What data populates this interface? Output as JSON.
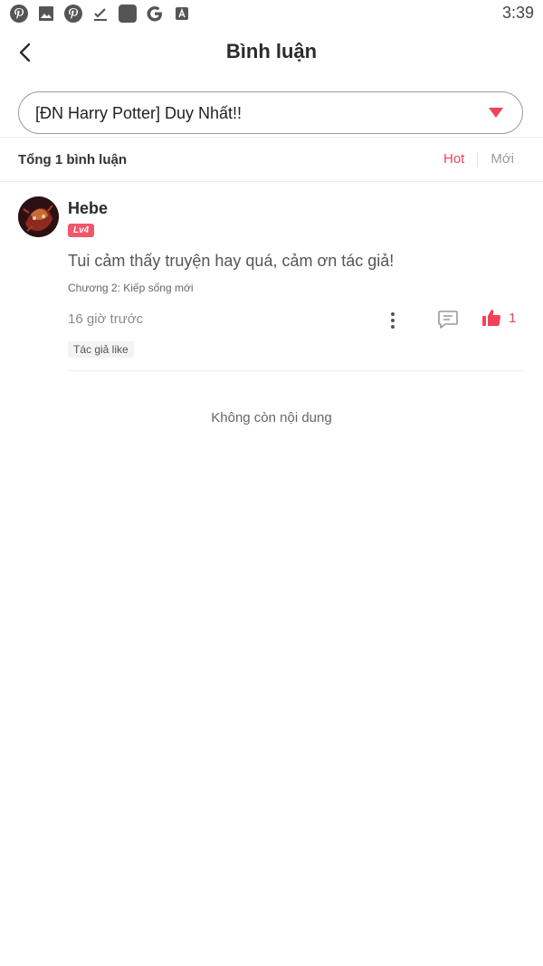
{
  "status_bar": {
    "icons": [
      "pinterest-icon",
      "image-icon",
      "pinterest-icon",
      "download-done-icon",
      "app-square-icon",
      "google-icon",
      "translate-icon"
    ],
    "time": "3:39"
  },
  "header": {
    "title": "Bình luận",
    "back_icon": "chevron-left-icon"
  },
  "story_selector": {
    "selected": "[ĐN Harry Potter] Duy Nhất!!",
    "caret_color": "#f0435a"
  },
  "summary": {
    "total_label": "Tổng 1 bình luận",
    "sort_tabs": [
      {
        "label": "Hot",
        "active": true
      },
      {
        "label": "Mới",
        "active": false
      }
    ]
  },
  "comments": [
    {
      "username": "Hebe",
      "level": "Lv4",
      "text": "Tui cảm thấy truyện hay quá, cảm ơn tác giả!",
      "chapter": "Chương 2: Kiếp sống mới",
      "time": "16 giờ trước",
      "likes": "1",
      "author_tag": "Tác giả like"
    }
  ],
  "footer": {
    "end_text": "Không còn nội dung"
  },
  "colors": {
    "accent": "#f0435a",
    "badge": "#f2566a"
  }
}
